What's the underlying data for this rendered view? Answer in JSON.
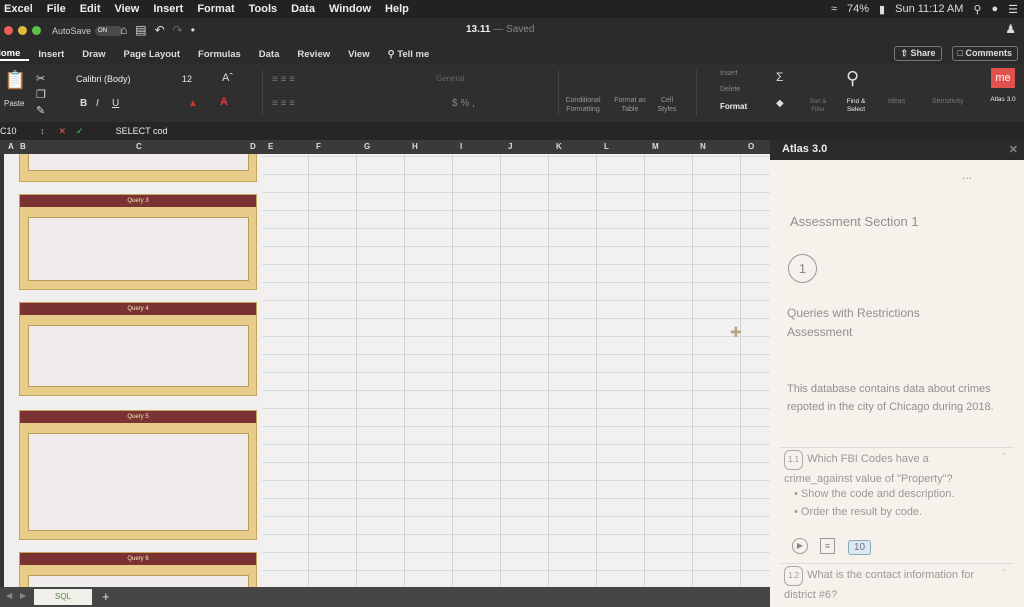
{
  "menubar": {
    "items": [
      "Excel",
      "File",
      "Edit",
      "View",
      "Insert",
      "Format",
      "Tools",
      "Data",
      "Window",
      "Help"
    ],
    "battery": "74%",
    "clock": "Sun 11:12 AM"
  },
  "titlebar": {
    "autosave_label": "AutoSave",
    "autosave_state": "ON",
    "doc_name": "13.11",
    "doc_status": "— Saved"
  },
  "tabs": [
    "Home",
    "Insert",
    "Draw",
    "Page Layout",
    "Formulas",
    "Data",
    "Review",
    "View"
  ],
  "tell_me": "Tell me",
  "share_label": "Share",
  "comments_label": "Comments",
  "ribbon": {
    "paste": "Paste",
    "font_name": "Calibri (Body)",
    "font_size": "12",
    "number_format": "General",
    "conditional_formatting": "Conditional Formatting",
    "format_as_table": "Format as Table",
    "cell_styles": "Cell Styles",
    "insert": "Insert",
    "delete": "Delete",
    "format": "Format",
    "sort_filter": "Sort & Filter",
    "find_select": "Find & Select",
    "ideas": "Ideas",
    "sensitivity": "Sensitivity",
    "atlas": "Atlas 3.0"
  },
  "formula_bar": {
    "cell_ref": "C10",
    "formula": "SELECT cod"
  },
  "columns": [
    "A",
    "B",
    "C",
    "D",
    "E",
    "F",
    "G",
    "H",
    "I",
    "J",
    "K",
    "L",
    "M",
    "N",
    "O"
  ],
  "queries": [
    "Query 3",
    "Query 4",
    "Query 5",
    "Query 6"
  ],
  "sheet_tab": "SQL",
  "pane": {
    "header": "Atlas 3.0",
    "more": "...",
    "section_title": "Assessment Section 1",
    "step_number": "1",
    "assessment_title": "Queries with Restrictions Assessment",
    "description": "This database contains data about crimes repoted in the city of Chicago during 2018.",
    "q1_badge": "1.1",
    "q1_text": "Which FBI Codes have a crime_against value of \"Property\"?",
    "q1_bullets": [
      "Show the code and description.",
      "Order the result by code."
    ],
    "points": "10",
    "q2_badge": "1.2",
    "q2_text": "What is the contact information for district #6?"
  }
}
